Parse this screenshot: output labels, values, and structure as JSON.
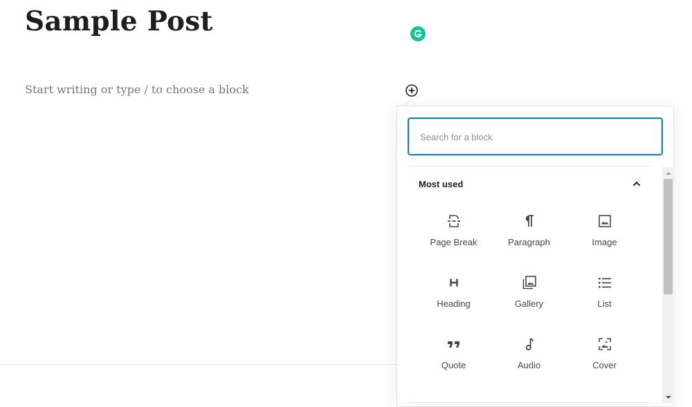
{
  "editor": {
    "post_title": "Sample Post",
    "block_placeholder": "Start writing or type / to choose a block"
  },
  "inserter": {
    "search": {
      "placeholder": "Search for a block",
      "value": ""
    },
    "panel": {
      "title": "Most used",
      "expanded": true
    },
    "blocks": [
      {
        "label": "Page Break",
        "icon": "page-break-icon"
      },
      {
        "label": "Paragraph",
        "icon": "paragraph-icon"
      },
      {
        "label": "Image",
        "icon": "image-icon"
      },
      {
        "label": "Heading",
        "icon": "heading-icon"
      },
      {
        "label": "Gallery",
        "icon": "gallery-icon"
      },
      {
        "label": "List",
        "icon": "list-icon"
      },
      {
        "label": "Quote",
        "icon": "quote-icon"
      },
      {
        "label": "Audio",
        "icon": "audio-icon"
      },
      {
        "label": "Cover",
        "icon": "cover-icon"
      }
    ]
  },
  "colors": {
    "accent": "#1f7ea1",
    "grammarly": "#15c39a",
    "text": "#1e1e1e",
    "muted": "#757575"
  }
}
